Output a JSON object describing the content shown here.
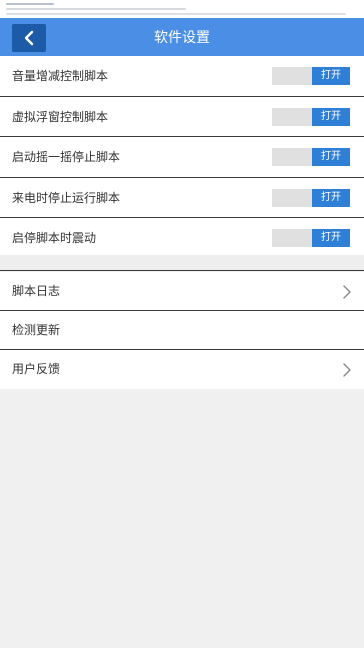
{
  "header": {
    "title": "软件设置",
    "back_icon": "chevron-left-icon"
  },
  "toggles": [
    {
      "label": "音量增减控制脚本",
      "state_label": "打开"
    },
    {
      "label": "虚拟浮窗控制脚本",
      "state_label": "打开"
    },
    {
      "label": "启动摇一摇停止脚本",
      "state_label": "打开"
    },
    {
      "label": "来电时停止运行脚本",
      "state_label": "打开"
    },
    {
      "label": "启停脚本时震动",
      "state_label": "打开"
    }
  ],
  "menu": [
    {
      "label": "脚本日志",
      "icon": "chevron-right-icon"
    },
    {
      "label": "检测更新"
    },
    {
      "label": "用户反馈",
      "icon": "chevron-right-icon"
    }
  ],
  "colors": {
    "header_bg": "#4a8ee6",
    "back_button_bg": "#1d5aa8",
    "toggle_on_bg": "#2f7fd7",
    "toggle_track_bg": "#e0e0e0",
    "page_bg": "#f0f0f0"
  }
}
